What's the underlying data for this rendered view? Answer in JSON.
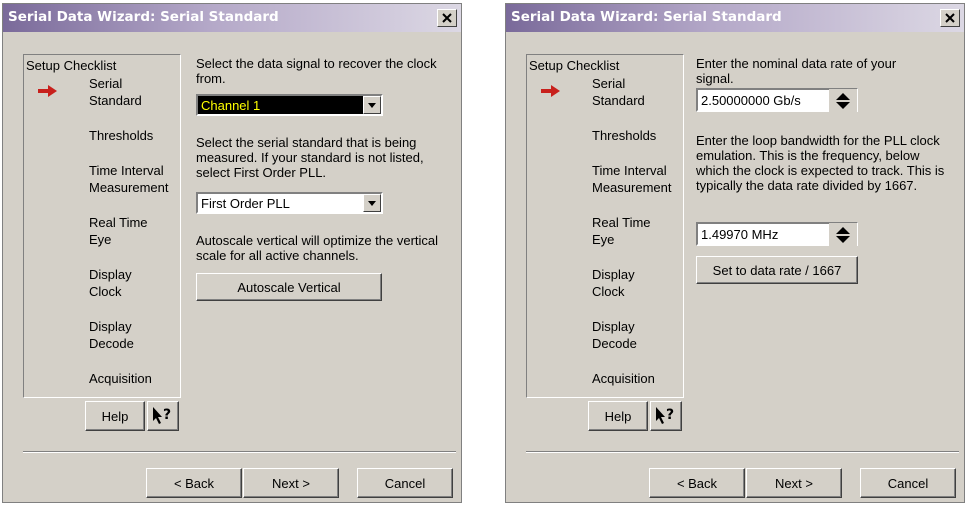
{
  "left_dialog": {
    "title": "Serial Data Wizard: Serial Standard",
    "checklist": {
      "title": "Setup Checklist",
      "items": [
        "Serial\nStandard",
        "Thresholds",
        "Time Interval\nMeasurement",
        "Real Time\nEye",
        "Display\nClock",
        "Display\nDecode",
        "Acquisition"
      ]
    },
    "signal_prompt": "Select the data signal to recover the clock from.",
    "signal_value": "Channel 1",
    "standard_prompt": "Select the serial standard that is being measured. If your standard is not listed, select First Order PLL.",
    "standard_value": "First Order PLL",
    "autoscale_prompt": "Autoscale vertical will optimize the vertical scale for all active channels.",
    "autoscale_button": "Autoscale Vertical",
    "help_button": "Help",
    "back_button": "< Back",
    "next_button": "Next >",
    "cancel_button": "Cancel"
  },
  "right_dialog": {
    "title": "Serial Data Wizard: Serial Standard",
    "checklist": {
      "title": "Setup Checklist",
      "items": [
        "Serial\nStandard",
        "Thresholds",
        "Time Interval\nMeasurement",
        "Real Time\nEye",
        "Display\nClock",
        "Display\nDecode",
        "Acquisition"
      ]
    },
    "rate_prompt": "Enter the nominal data rate of your signal.",
    "rate_value": "2.50000000 Gb/s",
    "bandwidth_prompt": "Enter the loop bandwidth for the PLL clock emulation. This is the frequency, below which the clock is expected to track. This is typically the data rate divided by 1667.",
    "bandwidth_value": "1.49970 MHz",
    "set_rate_button": "Set to data rate / 1667",
    "help_button": "Help",
    "back_button": "< Back",
    "next_button": "Next >",
    "cancel_button": "Cancel"
  },
  "colors": {
    "accent_arrow": "#c8201c",
    "titlebar_start": "#7a6a9a",
    "channel_combo_bg": "#000000",
    "channel_combo_text": "#ffff00"
  },
  "icons": [
    "close-icon",
    "current-step-arrow-icon",
    "chevron-down-icon",
    "whats-this-help-icon",
    "spin-up-icon",
    "spin-down-icon"
  ]
}
